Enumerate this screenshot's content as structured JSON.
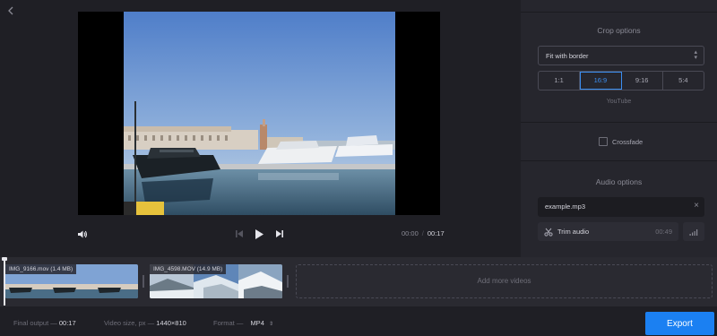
{
  "player": {
    "current_time": "00:00",
    "separator": "/",
    "duration": "00:17"
  },
  "panel": {
    "crop_title": "Crop options",
    "crop_mode": "Fit with border",
    "ratios": [
      {
        "label": "1:1",
        "active": false
      },
      {
        "label": "16:9",
        "active": true
      },
      {
        "label": "9:16",
        "active": false
      },
      {
        "label": "5:4",
        "active": false
      }
    ],
    "ratio_hint": "YouTube",
    "crossfade_label": "Crossfade",
    "crossfade_checked": false,
    "audio_title": "Audio options",
    "audio_file": "example.mp3",
    "trim_label": "Trim audio",
    "trim_time": "00:49"
  },
  "timeline": {
    "clips": [
      {
        "label": "IMG_9166.mov (1.4 MB)"
      },
      {
        "label": "IMG_4598.MOV (14.9 MB)"
      }
    ],
    "add_more": "Add more videos"
  },
  "bottom": {
    "final_output_label": "Final output —",
    "final_output_value": "00:17",
    "video_size_label": "Video size, px —",
    "video_size_value": "1440×810",
    "format_label": "Format —",
    "format_value": "MP4",
    "format_arrows": "⇕",
    "export_label": "Export"
  },
  "colors": {
    "accent": "#1b80f2",
    "active_ratio": "#3b8ef0",
    "background": "#1f1f25",
    "panel": "#26262d"
  },
  "icons": {
    "back": "chevron-left-icon",
    "volume": "speaker-icon",
    "prev": "skip-previous-icon",
    "play": "play-icon",
    "next": "skip-next-icon",
    "select_caret": "chevron-updown-icon",
    "remove": "close-icon",
    "trim": "scissors-icon",
    "volume_bars": "volume-bars-icon"
  }
}
